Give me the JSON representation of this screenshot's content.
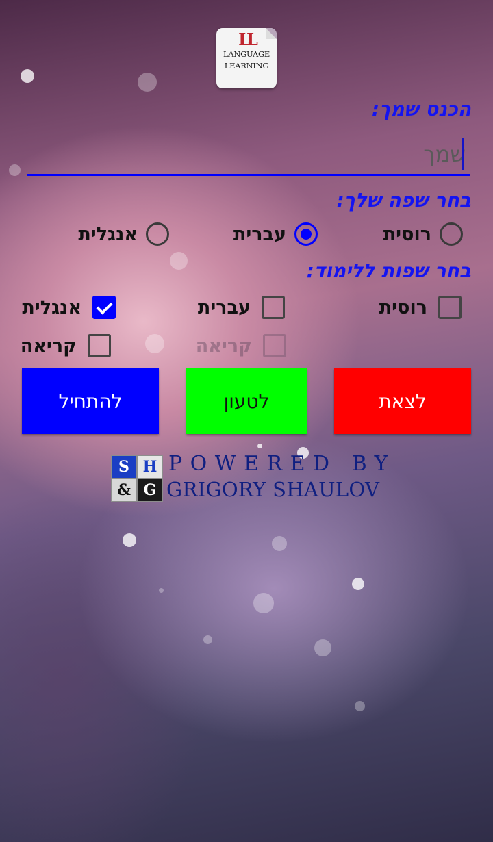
{
  "logo": {
    "monogram": "LL",
    "line1": "LANGUAGE",
    "line2": "LEARNING"
  },
  "name_section": {
    "label": "הכנס שמך:",
    "placeholder": "שמך",
    "value": ""
  },
  "language_section": {
    "label": "בחר שפה שלך:",
    "options": [
      {
        "label": "רוסית",
        "selected": false
      },
      {
        "label": "עברית",
        "selected": true
      },
      {
        "label": "אנגלית",
        "selected": false
      }
    ]
  },
  "learn_section": {
    "label": "בחר שפות ללימוד:",
    "options": [
      {
        "label": "רוסית",
        "checked": false,
        "enabled": true
      },
      {
        "label": "עברית",
        "checked": false,
        "enabled": true
      },
      {
        "label": "אנגלית",
        "checked": true,
        "enabled": true
      }
    ],
    "reading": [
      {
        "label": "קריאה",
        "checked": false,
        "enabled": false
      },
      {
        "label": "קריאה",
        "checked": false,
        "enabled": true
      }
    ]
  },
  "buttons": {
    "exit": "לצאת",
    "load": "לטעון",
    "start": "להתחיל"
  },
  "footer": {
    "logo_letters": [
      "S",
      "H",
      "&",
      "G"
    ],
    "powered_by": "POWERED BY",
    "author": "GRIGORY SHAULOV"
  },
  "colors": {
    "accent": "#0000ff",
    "exit": "#ff0000",
    "load": "#00ff00",
    "start": "#0000ff"
  }
}
